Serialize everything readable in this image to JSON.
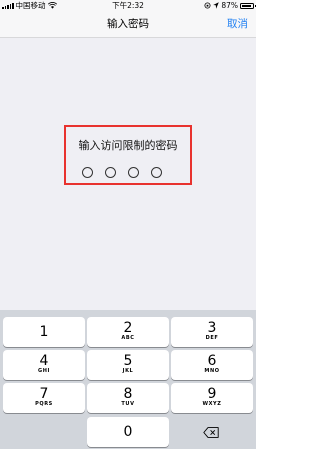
{
  "status_bar": {
    "carrier": "中国移动",
    "time": "下午2:32",
    "battery_text": "87%",
    "battery_level": 0.87
  },
  "nav": {
    "title": "输入密码",
    "cancel_label": "取消"
  },
  "passcode": {
    "prompt": "输入访问限制的密码",
    "digits_total": 4,
    "digits_entered": 0
  },
  "keypad": {
    "keys": [
      {
        "digit": "1",
        "letters": ""
      },
      {
        "digit": "2",
        "letters": "ABC"
      },
      {
        "digit": "3",
        "letters": "DEF"
      },
      {
        "digit": "4",
        "letters": "GHI"
      },
      {
        "digit": "5",
        "letters": "JKL"
      },
      {
        "digit": "6",
        "letters": "MNO"
      },
      {
        "digit": "7",
        "letters": "PQRS"
      },
      {
        "digit": "8",
        "letters": "TUV"
      },
      {
        "digit": "9",
        "letters": "WXYZ"
      },
      {
        "digit": "0",
        "letters": ""
      }
    ],
    "delete_icon": "backspace-icon"
  },
  "colors": {
    "accent": "#1f7ff2",
    "highlight_border": "#e8322e",
    "background": "#efeff4",
    "keypad_background": "#d1d5db"
  }
}
